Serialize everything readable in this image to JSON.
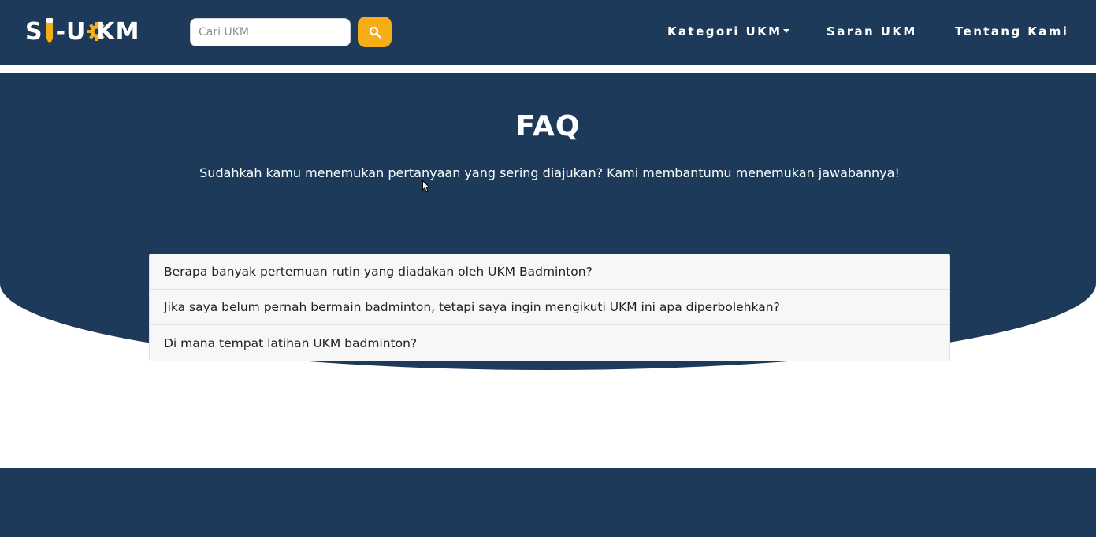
{
  "brand": {
    "logo_text_left": "S",
    "logo_text_mid": "-U",
    "logo_text_k": "K",
    "logo_text_right": "M",
    "accent_color": "#f6ad16",
    "primary_color": "#1e3a5a"
  },
  "search": {
    "placeholder": "Cari UKM",
    "value": "",
    "button_icon": "search-icon"
  },
  "nav": {
    "kategori_label": "Kategori UKM",
    "saran_label": "Saran UKM",
    "tentang_label": "Tentang Kami"
  },
  "hero": {
    "title": "FAQ",
    "subtitle": "Sudahkah kamu menemukan pertanyaan yang sering diajukan? Kami membantumu menemukan jawabannya!"
  },
  "faq": {
    "items": [
      {
        "question": "Berapa banyak pertemuan rutin yang diadakan oleh UKM Badminton?"
      },
      {
        "question": "Jika saya belum pernah bermain badminton, tetapi saya ingin mengikuti UKM ini apa diperbolehkan?"
      },
      {
        "question": "Di mana tempat latihan UKM badminton?"
      }
    ]
  }
}
